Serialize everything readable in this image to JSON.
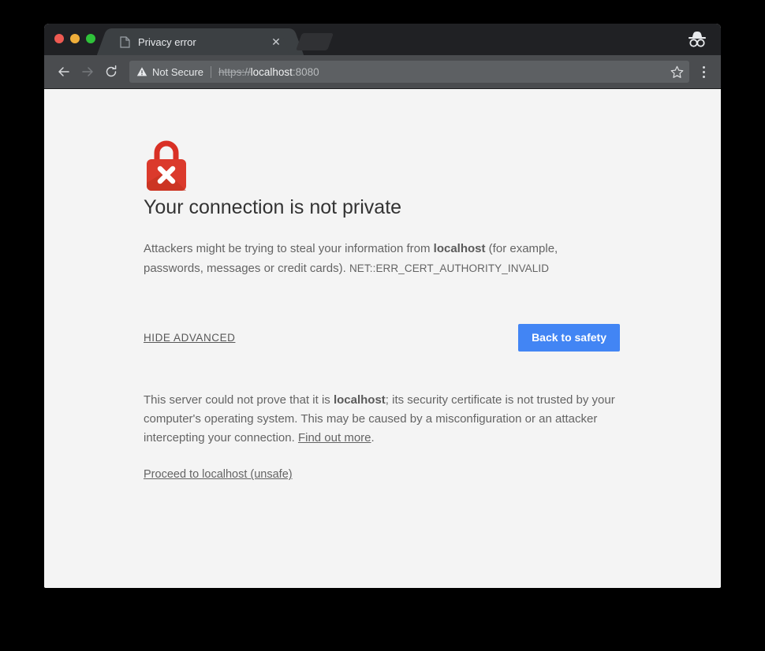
{
  "window": {
    "traffic_lights": [
      "close",
      "minimize",
      "maximize"
    ],
    "incognito_icon": "incognito-hat-glasses-icon"
  },
  "tab_strip": {
    "tabs": [
      {
        "title": "Privacy error",
        "favicon": "page-document-icon",
        "close_glyph": "✕"
      }
    ],
    "new_tab_label": ""
  },
  "toolbar": {
    "back_glyph": "←",
    "forward_glyph": "→",
    "reload_glyph": "⟳",
    "security_label": "Not Secure",
    "security_icon": "warning-triangle-icon",
    "url_scheme": "https://",
    "url_host": "localhost",
    "url_port": ":8080",
    "star_icon": "bookmark-star-icon",
    "menu_icon": "three-dot-menu-icon"
  },
  "page": {
    "icon": "red-padlock-error-icon",
    "heading": "Your connection is not private",
    "body_part1": "Attackers might be trying to steal your information from ",
    "body_host": "localhost",
    "body_part2": " (for example, passwords, messages or credit cards). ",
    "error_code": "NET::ERR_CERT_AUTHORITY_INVALID",
    "hide_advanced_label": "HIDE ADVANCED",
    "back_to_safety_label": "Back to safety",
    "advanced_part1": "This server could not prove that it is ",
    "advanced_host": "localhost",
    "advanced_part2": "; its security certificate is not trusted by your computer's operating system. This may be caused by a misconfiguration or an attacker intercepting your connection. ",
    "find_out_more_label": "Find out more",
    "advanced_part3": ".",
    "proceed_label": "Proceed to localhost (unsafe)"
  },
  "colors": {
    "accent_blue": "#4285f4",
    "error_red": "#d93025",
    "page_bg": "#f4f4f4",
    "tabstrip_bg": "#202124",
    "toolbar_bg": "#4a4c4f"
  }
}
